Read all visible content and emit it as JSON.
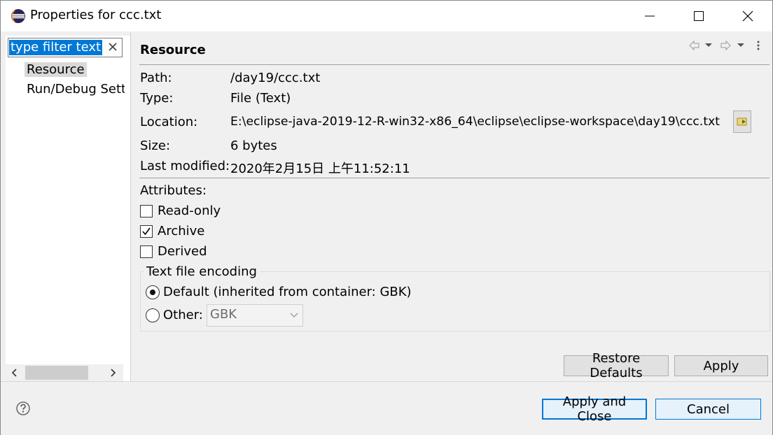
{
  "window": {
    "title": "Properties for ccc.txt"
  },
  "left": {
    "filter_value": "type filter text",
    "tree_items": [
      "Resource",
      "Run/Debug Sett"
    ]
  },
  "page": {
    "title": "Resource",
    "fields": [
      {
        "label": "Path:",
        "value": "/day19/ccc.txt"
      },
      {
        "label": "Type:",
        "value": "File  (Text)"
      },
      {
        "label": "Location:",
        "value": "E:\\eclipse-java-2019-12-R-win32-x86_64\\eclipse\\eclipse-workspace\\day19\\ccc.txt"
      },
      {
        "label": "Size:",
        "value": "6  bytes"
      },
      {
        "label": "Last modified:",
        "value": "2020年2月15日 上午11:52:11"
      }
    ],
    "attributes_label": "Attributes:",
    "attributes": [
      {
        "label": "Read-only",
        "checked": false
      },
      {
        "label": "Archive",
        "checked": true
      },
      {
        "label": "Derived",
        "checked": false
      }
    ],
    "encoding": {
      "group_title": "Text file encoding",
      "default_label": "Default (inherited from container: GBK)",
      "other_label": "Other:",
      "other_value": "GBK",
      "selected": "default"
    },
    "restore_label": "Restore Defaults",
    "apply_label": "Apply"
  },
  "footer": {
    "apply_close_label": "Apply and Close",
    "cancel_label": "Cancel"
  }
}
